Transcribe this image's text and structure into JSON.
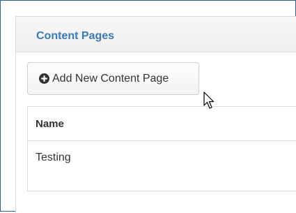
{
  "panel": {
    "title": "Content Pages"
  },
  "toolbar": {
    "add_label": "Add New Content Page",
    "add_icon": "plus-circle-icon"
  },
  "table": {
    "columns": [
      "Name"
    ],
    "rows": [
      {
        "name": "Testing"
      }
    ]
  },
  "colors": {
    "title": "#3a7bb5",
    "border": "#2f5d96"
  }
}
